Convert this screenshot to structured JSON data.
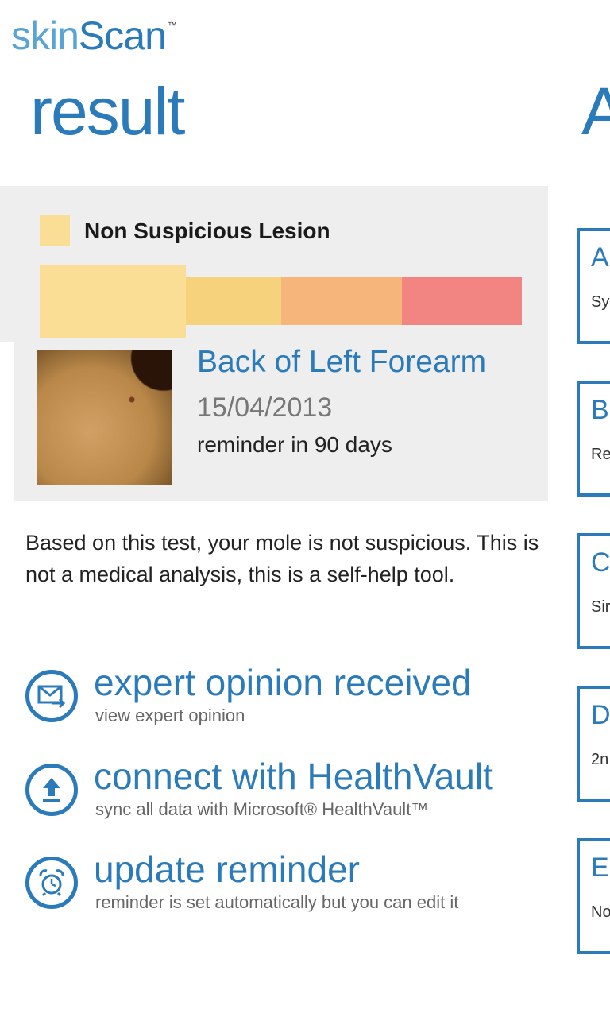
{
  "app": {
    "brand_light": "skin",
    "brand_bold": "Scan",
    "brand_tm": "™"
  },
  "page": {
    "title": "result",
    "next_pivot_title_partial": "A"
  },
  "result": {
    "risk_label": "Non Suspicious Lesion",
    "risk_scale_colors": [
      "#fbde95",
      "#f7d27d",
      "#f6b57b",
      "#f28582"
    ],
    "risk_level_index": 0,
    "location": "Back of Left Forearm",
    "date": "15/04/2013",
    "reminder": "reminder in 90 days",
    "thumbnail_icon": "mole-photo"
  },
  "disclaimer": "Based on this test, your mole is not suspicious. This is not a medical analysis, this is a self-help tool.",
  "actions": [
    {
      "title": "expert opinion received",
      "subtitle": "view expert opinion",
      "icon": "mail-forward-icon"
    },
    {
      "title": "connect with HealthVault",
      "subtitle": "sync all data with Microsoft® HealthVault™",
      "icon": "upload-icon"
    },
    {
      "title": "update reminder",
      "subtitle": "reminder is set automatically but you can edit it",
      "icon": "alarm-clock-icon"
    }
  ],
  "side_cards": [
    {
      "letter": "A",
      "sub": "Sy"
    },
    {
      "letter": "B",
      "sub": "Re"
    },
    {
      "letter": "C",
      "sub": "Sir"
    },
    {
      "letter": "D",
      "sub": "2n"
    },
    {
      "letter": "E",
      "sub": "No"
    }
  ],
  "colors": {
    "accent": "#2b7bbb",
    "panel_bg": "#eeeeee"
  }
}
